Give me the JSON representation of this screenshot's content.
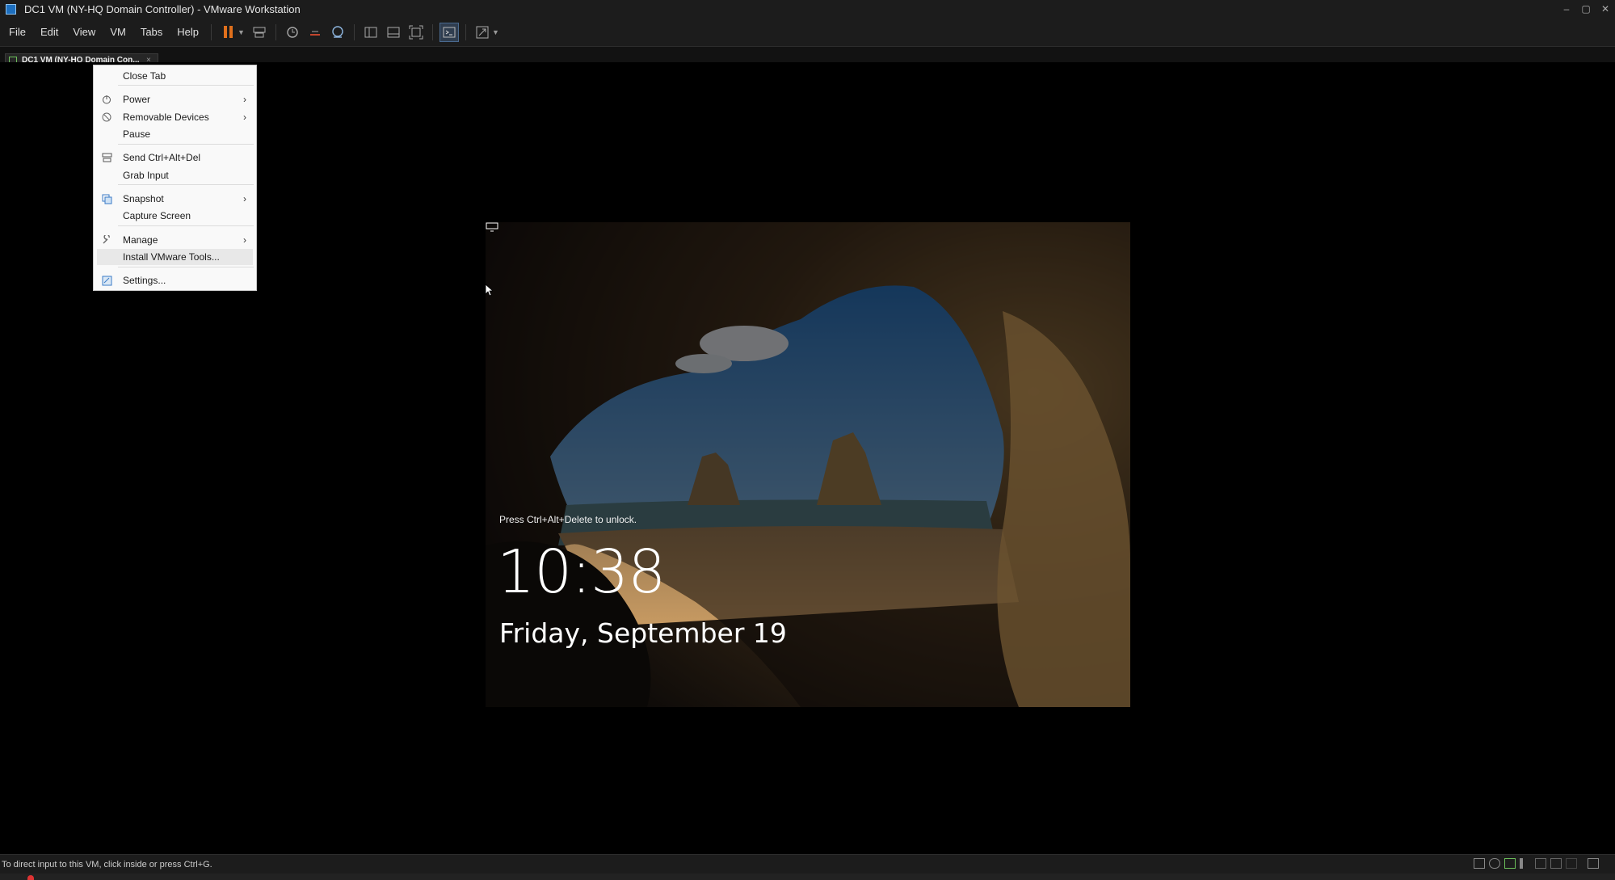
{
  "window": {
    "title": "DC1 VM (NY-HQ Domain Controller) - VMware Workstation",
    "controls": [
      "–",
      "▢",
      "✕"
    ]
  },
  "menubar": {
    "items": [
      "File",
      "Edit",
      "View",
      "VM",
      "Tabs",
      "Help"
    ]
  },
  "tab": {
    "label": "DC1 VM (NY-HQ Domain Con...",
    "close": "×"
  },
  "context_menu": {
    "items": [
      {
        "label": "Close Tab",
        "icon": "",
        "submenu": false
      },
      {
        "label": "Power",
        "icon": "power-icon",
        "submenu": true
      },
      {
        "label": "Removable Devices",
        "icon": "removable-devices-icon",
        "submenu": true
      },
      {
        "label": "Pause",
        "icon": "",
        "submenu": false
      },
      {
        "label": "Send Ctrl+Alt+Del",
        "icon": "send-ctrl-alt-del-icon",
        "submenu": false
      },
      {
        "label": "Grab Input",
        "icon": "",
        "submenu": false
      },
      {
        "label": "Snapshot",
        "icon": "snapshot-icon",
        "submenu": true
      },
      {
        "label": "Capture Screen",
        "icon": "",
        "submenu": false
      },
      {
        "label": "Manage",
        "icon": "wrench-icon",
        "submenu": true
      },
      {
        "label": "Install VMware Tools...",
        "icon": "",
        "submenu": false,
        "highlighted": true
      },
      {
        "label": "Settings...",
        "icon": "settings-icon",
        "submenu": false
      }
    ],
    "submenu_arrow": "›"
  },
  "lock_screen": {
    "prompt": "Press Ctrl+Alt+Delete to unlock.",
    "time": "10:38",
    "date": "Friday, September 19"
  },
  "statusbar": {
    "text": "To direct input to this VM, click inside or press Ctrl+G."
  },
  "colors": {
    "chrome_bg": "#1c1c1c",
    "pause_accent": "#e0701c",
    "menu_bg": "#f9f9f9"
  }
}
